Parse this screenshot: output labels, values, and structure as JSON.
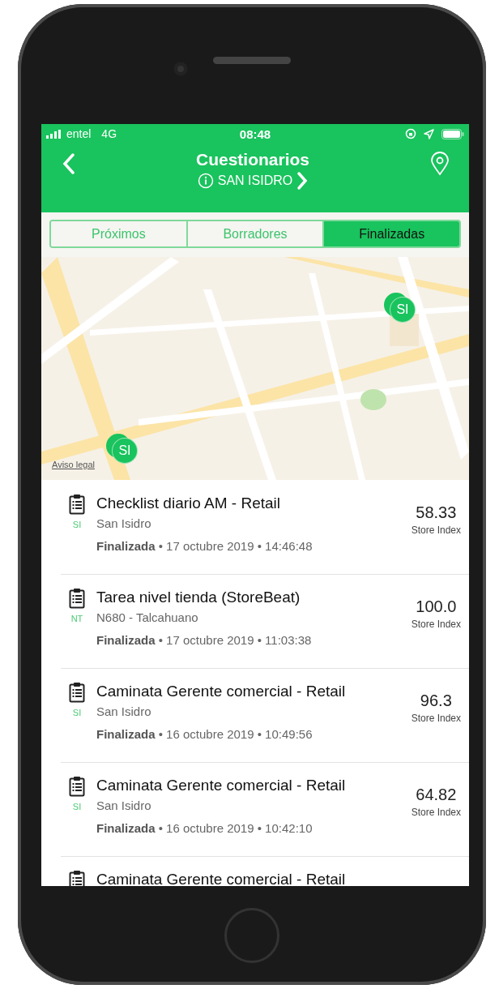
{
  "status_bar": {
    "carrier": "entel",
    "network": "4G",
    "time": "08:48"
  },
  "header": {
    "title": "Cuestionarios",
    "subtitle": "SAN ISIDRO"
  },
  "tabs": [
    {
      "label": "Próximos",
      "selected": false
    },
    {
      "label": "Borradores",
      "selected": false
    },
    {
      "label": "Finalizadas",
      "selected": true
    }
  ],
  "map": {
    "kind": "picture",
    "markers": [
      {
        "label": "SI"
      },
      {
        "label": "SI"
      }
    ],
    "legal_link": "Aviso legal"
  },
  "items": [
    {
      "badge": "SI",
      "title": "Checklist diario AM - Retail",
      "location": "San Isidro",
      "meta": "**Finalizada** • 17 octubre 2019 • 14:46:48",
      "score": "58.33",
      "score_label": "Store Index"
    },
    {
      "badge": "NT",
      "title": "Tarea nivel tienda (StoreBeat)",
      "location": "N680 - Talcahuano",
      "meta": "**Finalizada** • 17 octubre 2019 • 11:03:38",
      "score": "100.0",
      "score_label": "Store Index"
    },
    {
      "badge": "SI",
      "title": "Caminata Gerente comercial - Retail",
      "location": "San Isidro",
      "meta": "**Finalizada** • 16 octubre 2019 • 10:49:56",
      "score": "96.3",
      "score_label": "Store Index"
    },
    {
      "badge": "SI",
      "title": "Caminata Gerente comercial - Retail",
      "location": "San Isidro",
      "meta": "**Finalizada** • 16 octubre 2019 • 10:42:10",
      "score": "64.82",
      "score_label": "Store Index"
    },
    {
      "title": "Caminata Gerente comercial - Retail"
    }
  ]
}
